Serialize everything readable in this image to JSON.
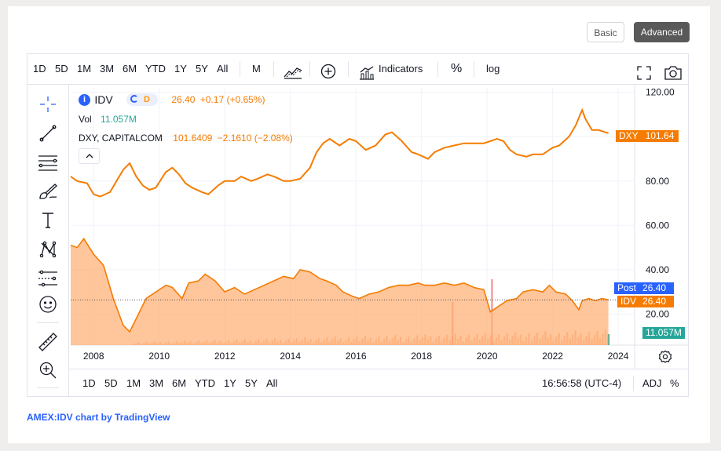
{
  "buttons": {
    "basic": "Basic",
    "advanced": "Advanced"
  },
  "toolbar": {
    "ranges": [
      "1D",
      "5D",
      "1M",
      "3M",
      "6M",
      "YTD",
      "1Y",
      "5Y",
      "All"
    ],
    "interval": "M",
    "indicators": "Indicators",
    "percent": "%",
    "log": "log"
  },
  "legend": {
    "symbol": "IDV",
    "info_icon": "i",
    "session_badge": "D",
    "last": "26.40",
    "change": "+0.17 (+0.65%)",
    "vol_label": "Vol",
    "vol_value": "11.057M",
    "compare_symbol": "DXY, CAPITALCOM",
    "compare_last": "101.6409",
    "compare_change": "−2.1610 (−2.08%)"
  },
  "price_tags": {
    "dxy_label": "DXY",
    "dxy_value": "101.64",
    "post_label": "Post",
    "post_value": "26.40",
    "idv_label": "IDV",
    "idv_value": "26.40",
    "volume": "11.057M"
  },
  "bottombar": {
    "ranges": [
      "1D",
      "5D",
      "1M",
      "3M",
      "6M",
      "YTD",
      "1Y",
      "5Y",
      "All"
    ],
    "time": "16:56:58 (UTC-4)",
    "adj": "ADJ",
    "percent": "%"
  },
  "footer": "AMEX:IDV chart by TradingView",
  "colors": {
    "dxy_line": "#f57c00",
    "idv_area": "#ffb27a",
    "idv_line": "#f57c00",
    "post": "#2962ff",
    "volume_bar": "#f7a472",
    "last_volume": "#26a69a"
  },
  "icons": [
    "crosshair-icon",
    "trend-line-icon",
    "fib-icon",
    "brush-icon",
    "text-icon",
    "pattern-icon",
    "forecast-icon",
    "emoji-icon",
    "ruler-icon",
    "zoom-in-icon",
    "chart-type-icon",
    "add-icon",
    "indicators-icon",
    "fullscreen-icon",
    "camera-icon",
    "settings-icon",
    "chevron-up-icon"
  ],
  "chart_data": {
    "type": "line",
    "x_axis_ticks": [
      "2008",
      "2010",
      "2012",
      "2014",
      "2016",
      "2018",
      "2020",
      "2022",
      "2024"
    ],
    "y_axis_ticks": [
      20,
      40,
      60,
      80,
      100,
      120
    ],
    "y_tick_labels": [
      "20.00",
      "40.00",
      "60.00",
      "80.00",
      "100.00",
      "120.00"
    ],
    "ylim": [
      6,
      122
    ],
    "xlim": [
      2007.3,
      2024.5
    ],
    "grid": true,
    "series": [
      {
        "name": "DXY",
        "style": "line",
        "x": [
          2007.3,
          2007.5,
          2007.8,
          2008.0,
          2008.2,
          2008.5,
          2008.7,
          2008.9,
          2009.1,
          2009.3,
          2009.5,
          2009.7,
          2009.9,
          2010.2,
          2010.4,
          2010.6,
          2010.8,
          2011.0,
          2011.3,
          2011.5,
          2011.8,
          2012.0,
          2012.3,
          2012.5,
          2012.8,
          2013.0,
          2013.3,
          2013.5,
          2013.8,
          2014.0,
          2014.3,
          2014.6,
          2014.8,
          2015.0,
          2015.2,
          2015.5,
          2015.8,
          2016.0,
          2016.3,
          2016.6,
          2016.9,
          2017.1,
          2017.4,
          2017.7,
          2017.9,
          2018.2,
          2018.4,
          2018.7,
          2019.0,
          2019.3,
          2019.6,
          2019.9,
          2020.1,
          2020.3,
          2020.5,
          2020.7,
          2020.9,
          2021.2,
          2021.4,
          2021.7,
          2022.0,
          2022.2,
          2022.5,
          2022.7,
          2022.9,
          2023.0,
          2023.2,
          2023.4,
          2023.6,
          2023.7
        ],
        "y": [
          82,
          80,
          79,
          74,
          73,
          75,
          80,
          85,
          88,
          82,
          78,
          76,
          77,
          84,
          86,
          83,
          79,
          77,
          75,
          74,
          78,
          80,
          80,
          82,
          80,
          81,
          83,
          82,
          80,
          80,
          81,
          86,
          93,
          97,
          99,
          96,
          99,
          98,
          94,
          96,
          101,
          102,
          98,
          93,
          92,
          90,
          93,
          95,
          96,
          97,
          97,
          97,
          98,
          99,
          98,
          94,
          92,
          91,
          92,
          92,
          95,
          96,
          100,
          105,
          112,
          108,
          103,
          103,
          102,
          101.64
        ]
      },
      {
        "name": "IDV",
        "style": "area",
        "x": [
          2007.3,
          2007.5,
          2007.7,
          2008.0,
          2008.3,
          2008.6,
          2008.9,
          2009.1,
          2009.3,
          2009.6,
          2009.9,
          2010.2,
          2010.4,
          2010.7,
          2010.9,
          2011.2,
          2011.4,
          2011.7,
          2012.0,
          2012.3,
          2012.6,
          2012.9,
          2013.2,
          2013.5,
          2013.8,
          2014.1,
          2014.3,
          2014.6,
          2014.9,
          2015.1,
          2015.4,
          2015.6,
          2015.9,
          2016.1,
          2016.4,
          2016.7,
          2017.0,
          2017.3,
          2017.6,
          2017.9,
          2018.1,
          2018.4,
          2018.7,
          2019.0,
          2019.3,
          2019.6,
          2019.9,
          2020.1,
          2020.2,
          2020.4,
          2020.6,
          2020.9,
          2021.1,
          2021.4,
          2021.7,
          2021.9,
          2022.1,
          2022.4,
          2022.6,
          2022.8,
          2022.9,
          2023.1,
          2023.3,
          2023.5,
          2023.7
        ],
        "y": [
          51,
          50,
          54,
          47,
          42,
          27,
          15,
          12,
          18,
          27,
          30,
          33,
          32,
          27,
          34,
          35,
          38,
          35,
          30,
          32,
          29,
          31,
          33,
          35,
          37,
          36,
          40,
          39,
          36,
          35,
          33,
          30,
          28,
          27,
          29,
          30,
          32,
          33,
          33,
          34,
          33,
          33,
          34,
          33,
          34,
          32,
          31,
          21,
          22,
          24,
          26,
          27,
          30,
          31,
          30,
          33,
          30,
          29,
          26,
          22,
          26,
          27,
          26,
          27,
          26.4
        ]
      }
    ],
    "volume_bars": {
      "name": "Vol",
      "last": "11.057M"
    }
  }
}
